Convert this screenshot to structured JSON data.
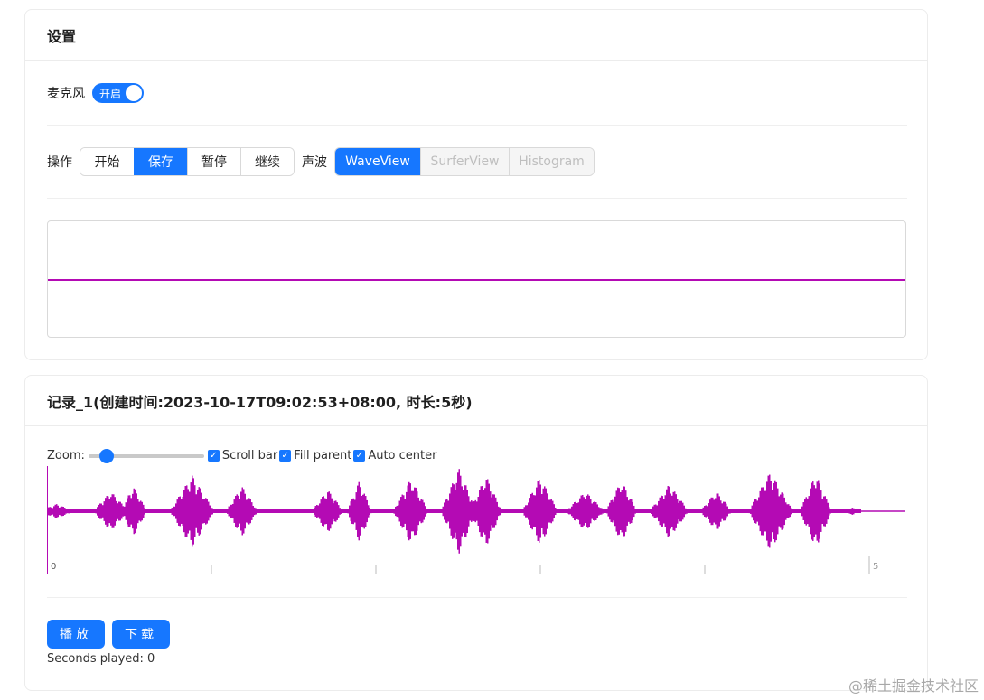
{
  "settings": {
    "title": "设置",
    "mic_label": "麦克风",
    "mic_switch_text": "开启",
    "ops_label": "操作",
    "ops": [
      "开始",
      "保存",
      "暂停",
      "继续"
    ],
    "wave_label": "声波",
    "views": [
      "WaveView",
      "SurferView",
      "Histogram"
    ]
  },
  "record": {
    "title": "记录_1(创建时间:2023-10-17T09:02:53+08:00, 时长:5秒)",
    "zoom_label": "Zoom:",
    "scrollbar_label": "Scroll bar",
    "fill_parent_label": "Fill parent",
    "auto_center_label": "Auto center",
    "timeline_start": "0",
    "timeline_end": "5",
    "play_button": "播放",
    "download_button": "下载",
    "seconds_played": "Seconds played: 0"
  },
  "colors": {
    "accent": "#1677ff",
    "wave": "#b40ab4"
  },
  "watermark": "@稀土掘金技术社区"
}
